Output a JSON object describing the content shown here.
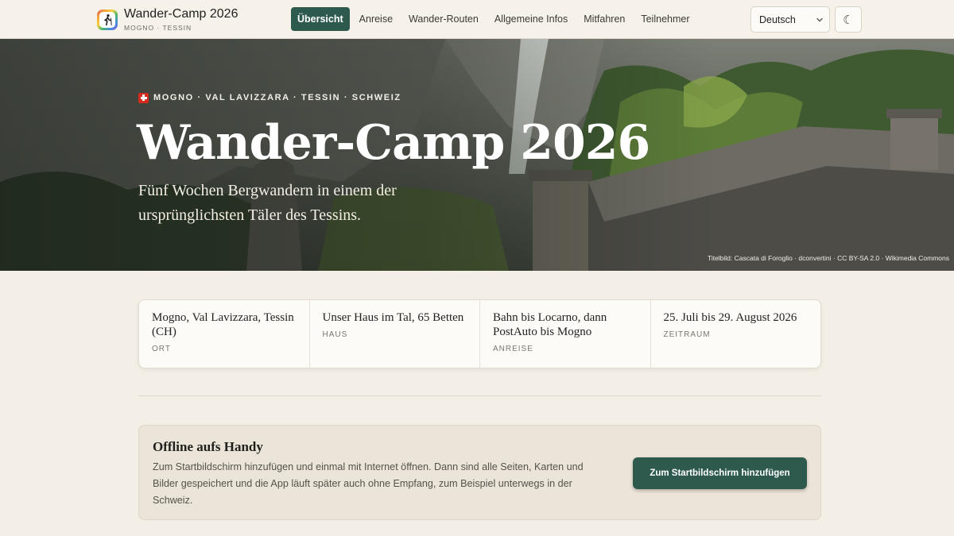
{
  "brand": {
    "title": "Wander-Camp 2026",
    "subtitle": "MOGNO · TESSIN",
    "icon": "hiker-icon"
  },
  "nav": {
    "items": [
      {
        "label": "Übersicht",
        "active": true
      },
      {
        "label": "Anreise"
      },
      {
        "label": "Wander-Routen"
      },
      {
        "label": "Allgemeine Infos"
      },
      {
        "label": "Mitfahren"
      },
      {
        "label": "Teilnehmer"
      }
    ]
  },
  "language": {
    "selected": "Deutsch"
  },
  "theme_toggle": {
    "glyph": "☾",
    "icon": "moon-icon"
  },
  "hero": {
    "eyebrow": "MOGNO · VAL LAVIZZARA · TESSIN · SCHWEIZ",
    "title": "Wander-Camp 2026",
    "subtitle": "Fünf Wochen Bergwandern in einem der ursprünglichsten Täler des Tessins.",
    "credit": "Titelbild: Cascata di Foroglio · dconvertini · CC BY-SA 2.0 · Wikimedia Commons"
  },
  "facts": [
    {
      "value": "Mogno, Val Lavizzara, Tessin (CH)",
      "label": "ORT"
    },
    {
      "value": "Unser Haus im Tal, 65 Betten",
      "label": "HAUS"
    },
    {
      "value": "Bahn bis Locarno, dann PostAuto bis Mogno",
      "label": "ANREISE"
    },
    {
      "value": "25. Juli bis 29. August 2026",
      "label": "ZEITRAUM"
    }
  ],
  "offline": {
    "title": "Offline aufs Handy",
    "text": "Zum Startbildschirm hinzufügen und einmal mit Internet öffnen. Dann sind alle Seiten, Karten und Bilder gespeichert und die App läuft später auch ohne Empfang, zum Beispiel unterwegs in der Schweiz.",
    "button": "Zum Startbildschirm hinzufügen"
  },
  "colors": {
    "accent": "#2e5a4e",
    "background": "#f3efe6",
    "flag": "#d52b1e"
  }
}
